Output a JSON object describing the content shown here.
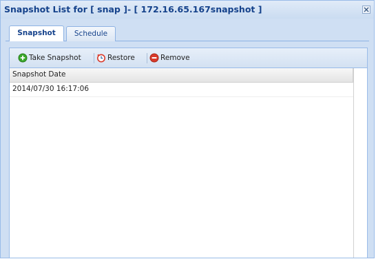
{
  "window": {
    "title": "Snapshot List for [ snap ]- [ 172.16.65.167snapshot ]"
  },
  "tabs": [
    {
      "label": "Snapshot",
      "active": true
    },
    {
      "label": "Schedule",
      "active": false
    }
  ],
  "toolbar": {
    "take_snapshot_label": "Take Snapshot",
    "restore_label": "Restore",
    "remove_label": "Remove",
    "icons": {
      "take": "add-circle-icon",
      "restore": "restore-clock-icon",
      "remove": "remove-circle-icon"
    }
  },
  "grid": {
    "columns": [
      "Snapshot Date"
    ],
    "rows": [
      [
        "2014/07/30 16:17:06"
      ]
    ]
  },
  "colors": {
    "title_text": "#15428b",
    "accent_green": "#3aa82a",
    "accent_red": "#d93a2b",
    "window_border": "#99bbe8"
  }
}
